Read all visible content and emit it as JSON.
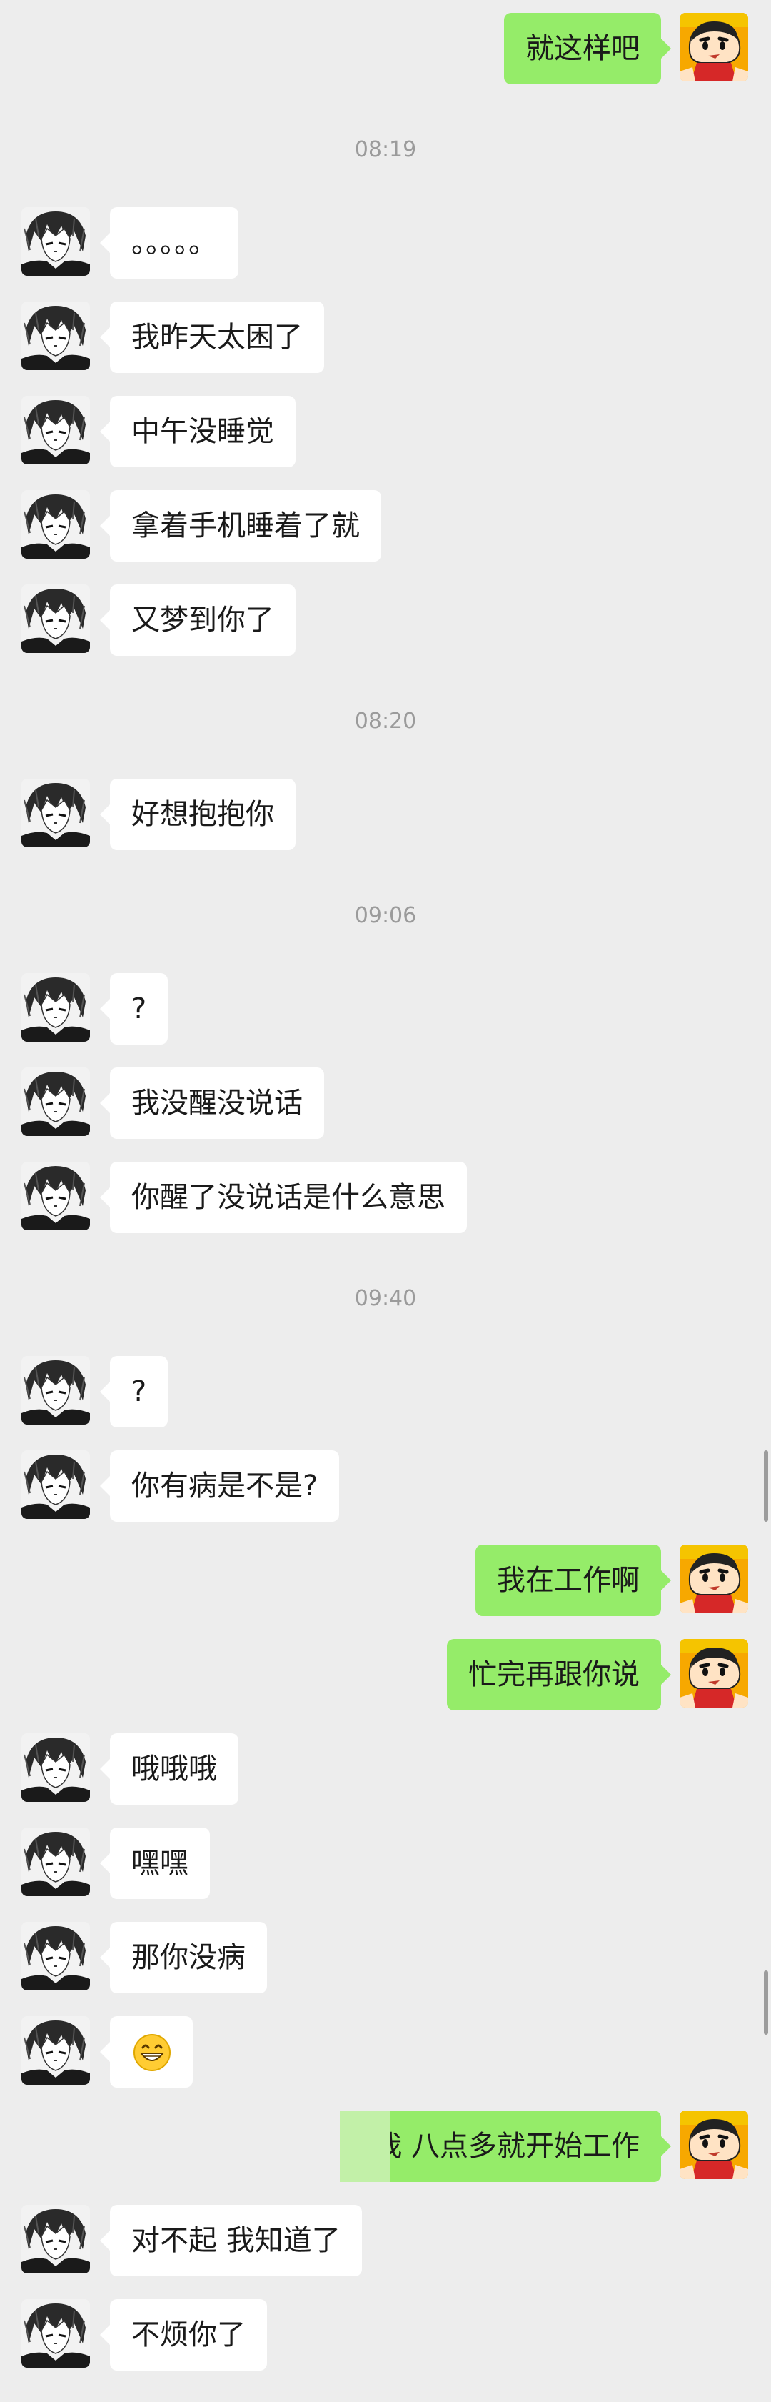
{
  "colors": {
    "background": "#ededed",
    "incoming_bubble": "#ffffff",
    "outgoing_bubble": "#95ec69",
    "timestamp": "#9b9b9b"
  },
  "messages": {
    "m0": "就这样吧",
    "t1": "08:19",
    "m1": "。。。。。",
    "m2": "我昨天太困了",
    "m3": "中午没睡觉",
    "m4": "拿着手机睡着了就",
    "m5": "又梦到你了",
    "t2": "08:20",
    "m6": "好想抱抱你",
    "t3": "09:06",
    "m7": "?",
    "m8": "我没醒没说话",
    "m9": "你醒了没说话是什么意思",
    "t4": "09:40",
    "m10": "?",
    "m11": "你有病是不是?",
    "m12": "我在工作啊",
    "m13": "忙完再跟你说",
    "m14": "哦哦哦",
    "m15": "嘿嘿",
    "m16": "那你没病",
    "m17_icon": "grinning-emoji",
    "m18": "我 八点多就开始工作",
    "m19": "对不起 我知道了",
    "m20": "不烦你了"
  },
  "icons": {
    "contact_avatar": "manga-portrait",
    "my_avatar": "cartoon-boy"
  }
}
